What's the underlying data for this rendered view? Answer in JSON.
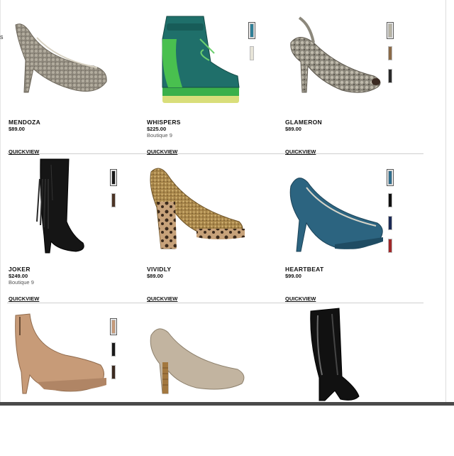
{
  "edge_text": "s",
  "quickview_label": "QUICKVIEW",
  "products": [
    {
      "name": "MENDOZA",
      "price": "$89.00",
      "boutique": "",
      "icon": "snakeskin-platform-pump",
      "swatches": []
    },
    {
      "name": "WHISPERS",
      "price": "$225.00",
      "boutique": "Boutique 9",
      "icon": "green-wedge-sneaker",
      "swatches": [
        "#2f7f97",
        "#e7e4d8"
      ]
    },
    {
      "name": "GLAMERON",
      "price": "$89.00",
      "boutique": "",
      "icon": "snakeskin-slingback-peeptoe",
      "swatches": [
        "#b7b3a4",
        "#8a6a48",
        "#2a2a2a"
      ]
    },
    {
      "name": "JOKER",
      "price": "$249.00",
      "boutique": "Boutique 9",
      "icon": "black-fringe-boot",
      "swatches": [
        "#1a1a1a",
        "#4b3426"
      ]
    },
    {
      "name": "VIVIDLY",
      "price": "$89.00",
      "boutique": "",
      "icon": "glitter-leopard-pump",
      "swatches": []
    },
    {
      "name": "HEARTBEAT",
      "price": "$99.00",
      "boutique": "",
      "icon": "blue-suede-pump",
      "swatches": [
        "#2f6d8c",
        "#111111",
        "#1c2a55",
        "#a0282a"
      ]
    },
    {
      "name": "",
      "price": "",
      "boutique": "",
      "icon": "nude-zip-bootie",
      "swatches": [
        "#c69b7b",
        "#1a1a1a",
        "#3b2a20"
      ]
    },
    {
      "name": "",
      "price": "",
      "boutique": "",
      "icon": "taupe-stacked-pump",
      "swatches": []
    },
    {
      "name": "",
      "price": "",
      "boutique": "",
      "icon": "black-patent-knee-boot",
      "swatches": []
    }
  ]
}
